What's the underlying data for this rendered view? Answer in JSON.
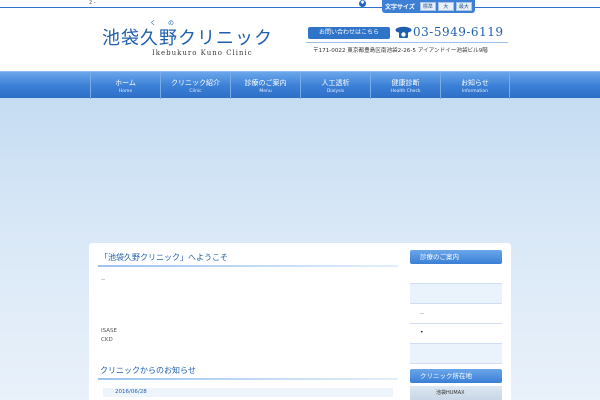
{
  "top": {
    "page_number": "2 -",
    "circle_glyph": "✱"
  },
  "font_size": {
    "label": "文字サイズ",
    "options": [
      "標準",
      "大",
      "最大"
    ]
  },
  "logo": {
    "title": "池袋久野クリニック",
    "ruby_ku": "く",
    "ruby_no": "の",
    "english": "Ikebukuro Kuno Clinic"
  },
  "contact": {
    "inquiry_label": "お問い合わせはこちら",
    "phone": "03-5949-6119",
    "address": "〒171-0022 東京都豊島区南池袋2-26-5 アイアンドイー池袋ビル9階"
  },
  "nav": {
    "items": [
      {
        "ja": "ホーム",
        "en": "Home"
      },
      {
        "ja": "クリニック紹介",
        "en": "Clinic"
      },
      {
        "ja": "診療のご案内",
        "en": "Menu"
      },
      {
        "ja": "人工透析",
        "en": "Dialysis"
      },
      {
        "ja": "健康診断",
        "en": "Health Check"
      },
      {
        "ja": "お知らせ",
        "en": "Information"
      }
    ]
  },
  "welcome": {
    "title": "「池袋久野クリニック」へようこそ",
    "dots": "‥",
    "line1": "ISASE",
    "line2": "CKD"
  },
  "news": {
    "title": "クリニックからのお知らせ",
    "date": "2016/06/28"
  },
  "sidebar": {
    "menu_heading": "診療のご案内",
    "rows": [
      "",
      "",
      "‥",
      "•",
      ""
    ],
    "location_heading": "クリニック所在地",
    "map_caption": "池袋HUMAX"
  },
  "colors": {
    "primary": "#2f74c9",
    "dark_blue": "#1f5fae",
    "nav_light": "#6aa6ea"
  }
}
